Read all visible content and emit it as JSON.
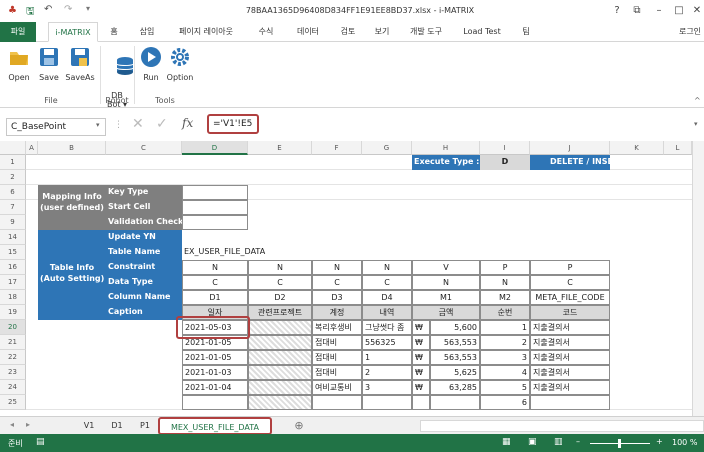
{
  "title_bar": {
    "title": "78BAA1365D96408D834FF1E91EE8BD37.xlsx - i-MATRIX",
    "help": "?",
    "restore": "⧉",
    "minimize": "–",
    "maximize": "□",
    "close": "✕"
  },
  "tabs": [
    "파일",
    "i-MATRIX",
    "홈",
    "삽입",
    "페이지 레이아웃",
    "수식",
    "데이터",
    "검토",
    "보기",
    "개발 도구",
    "Load Test",
    "팀"
  ],
  "login_label": "로그인",
  "ribbon": {
    "file_group": {
      "label": "File",
      "buttons": [
        "Open",
        "Save",
        "SaveAs"
      ]
    },
    "robot_group": {
      "label": "Robot",
      "buttons": [
        "DB\nBot ▾"
      ]
    },
    "tools_group": {
      "label": "Tools",
      "buttons": [
        "Run",
        "Option"
      ]
    }
  },
  "formula_bar": {
    "name_box": "C_BasePoint",
    "fx": "fx",
    "formula": "='V1'!E5"
  },
  "columns": [
    "A",
    "B",
    "C",
    "D",
    "E",
    "F",
    "G",
    "H",
    "I",
    "J",
    "K",
    "L"
  ],
  "rows": [
    "1",
    "2",
    "6",
    "7",
    "9",
    "14",
    "15",
    "16",
    "17",
    "18",
    "19",
    "20",
    "21",
    "22",
    "23",
    "24",
    "25"
  ],
  "header_row": {
    "execute_type_label": "Execute Type :",
    "execute_type_value": "D",
    "mode": "DELETE / INSE"
  },
  "mapping_info": {
    "title": "Mapping Info\n(user defined)",
    "items": [
      "Key Type",
      "Start Cell",
      "Validation Check"
    ]
  },
  "table_info": {
    "title": "Table Info\n(Auto Setting)",
    "items": [
      "Update YN",
      "Table Name",
      "Constraint",
      "Data Type",
      "Column Name",
      "Caption"
    ],
    "table_name": "EX_USER_FILE_DATA"
  },
  "table_grid": {
    "constraint": [
      "N",
      "N",
      "N",
      "N",
      "V",
      "P",
      "P"
    ],
    "data_type": [
      "C",
      "C",
      "C",
      "C",
      "N",
      "N",
      "C"
    ],
    "column_name": [
      "D1",
      "D2",
      "D3",
      "D4",
      "M1",
      "M2",
      "META_FILE_CODE"
    ],
    "caption": [
      "일자",
      "관련프로젝트",
      "계정",
      "내역",
      "금액",
      "순번",
      "코드"
    ],
    "data_rows": [
      [
        "2021-05-03",
        "",
        "복리후생비",
        "그냥썻다 좀",
        "₩",
        "5,600",
        "1",
        "지출결의서"
      ],
      [
        "2021-01-05",
        "",
        "접대비",
        "556325",
        "₩",
        "563,553",
        "2",
        "지출결의서"
      ],
      [
        "2021-01-05",
        "",
        "접대비",
        "1",
        "₩",
        "563,553",
        "3",
        "지출결의서"
      ],
      [
        "2021-01-03",
        "",
        "접대비",
        "2",
        "₩",
        "5,625",
        "4",
        "지출결의서"
      ],
      [
        "2021-01-04",
        "",
        "여비교통비",
        "3",
        "₩",
        "63,285",
        "5",
        "지출결의서"
      ],
      [
        "",
        "",
        "",
        "",
        "",
        "",
        "6",
        ""
      ]
    ]
  },
  "sheet_tabs": [
    "V1",
    "D1",
    "P1",
    "MEX_USER_FILE_DATA"
  ],
  "add_sheet": "⊕",
  "status": {
    "ready": "준비",
    "zoom": "100 %"
  }
}
